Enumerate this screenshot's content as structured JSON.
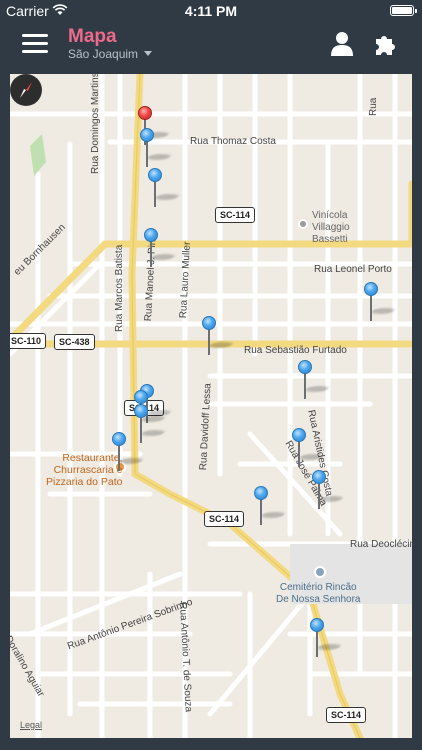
{
  "status_bar": {
    "carrier": "Carrier",
    "time": "4:11 PM"
  },
  "nav": {
    "title": "Mapa",
    "subtitle": "São Joaquim"
  },
  "map": {
    "legal": "Legal",
    "street_labels": {
      "domingos_martins": "Rua Domingos Martins",
      "thomaz_costa": "Rua Thomaz Costa",
      "bornhausen": "eu Bornhausen",
      "marcos_batista": "Rua Marcos Batista",
      "manoel_j_pinto": "Rua Manoel J. Pinto",
      "lauro_muller": "Rua Lauro Muller",
      "leonel_porto": "Rua Leonel Porto",
      "sebastiao_furtado": "Rua Sebastião Furtado",
      "davidoff_lessa": "Rua Davidoff Lessa",
      "aristides_costa": "Rua Aristides Costa",
      "jose_palma": "Rua José Palma",
      "deocleci": "Rua Deoclécir",
      "antonio_pereira_sobrinho": "Rua Antônio Pereira Sobrinho",
      "antonio_t_souza": "Rua Antônio T. de Souza",
      "doralino_aguiar": "Doralino Aguiar",
      "top_right": "Rua"
    },
    "shields": {
      "sc114_top": "SC-114",
      "sc110": "SC-110",
      "sc438": "SC-438",
      "sc114_mid": "SC-114",
      "sc114_lower": "SC-114",
      "sc114_bottom": "SC-114"
    },
    "pois": {
      "vinicola_line1": "Vinícola",
      "vinicola_line2": "Villaggio",
      "vinicola_line3": "Bassetti",
      "restaurante_line1": "Restaurante,",
      "restaurante_line2": "Churrascaria e",
      "restaurante_line3": "Pizzaria do Pato",
      "cemiterio_line1": "Cemitério Rincão",
      "cemiterio_line2": "De Nossa Senhora"
    },
    "pin_colors": {
      "default": "#4aa5ec",
      "selected": "#ee4646"
    }
  }
}
